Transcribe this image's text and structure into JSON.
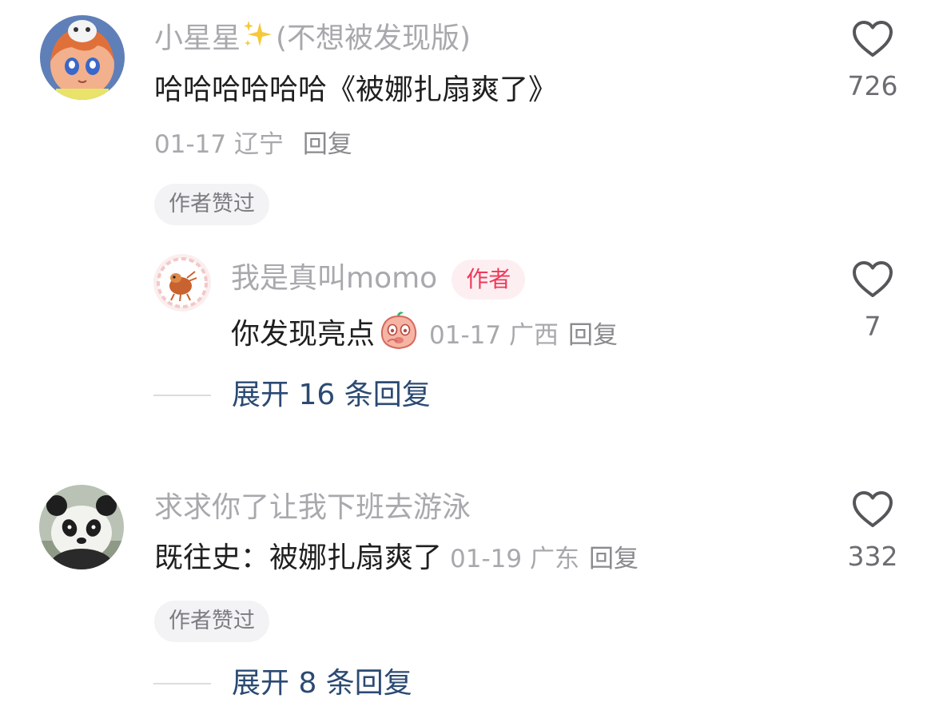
{
  "comments": [
    {
      "username": "小星星",
      "username_suffix": "(不想被发现版)",
      "username_emoji": "sparkles-icon",
      "text": "哈哈哈哈哈哈《被娜扎扇爽了》",
      "date": "01-17",
      "location": "辽宁",
      "reply_label": "回复",
      "badge": "作者赞过",
      "likes": "726",
      "replies": [
        {
          "username": "我是真叫momo",
          "author_tag": "作者",
          "text": "你发现亮点",
          "sticker": "peach-face-sticker",
          "date": "01-17",
          "location": "广西",
          "reply_label": "回复",
          "likes": "7"
        }
      ],
      "expand_label": "展开 16 条回复"
    },
    {
      "username": "求求你了让我下班去游泳",
      "text": "既往史：被娜扎扇爽了",
      "date": "01-19",
      "location": "广东",
      "reply_label": "回复",
      "badge": "作者赞过",
      "likes": "332",
      "expand_label": "展开 8 条回复"
    }
  ],
  "colors": {
    "username": "#a8a8ad",
    "text": "#1f1f1f",
    "expand_link": "#2b4a73",
    "author_tag": "#f0395a",
    "author_tag_bg": "#fdeff1",
    "badge_bg": "#f3f3f5"
  }
}
